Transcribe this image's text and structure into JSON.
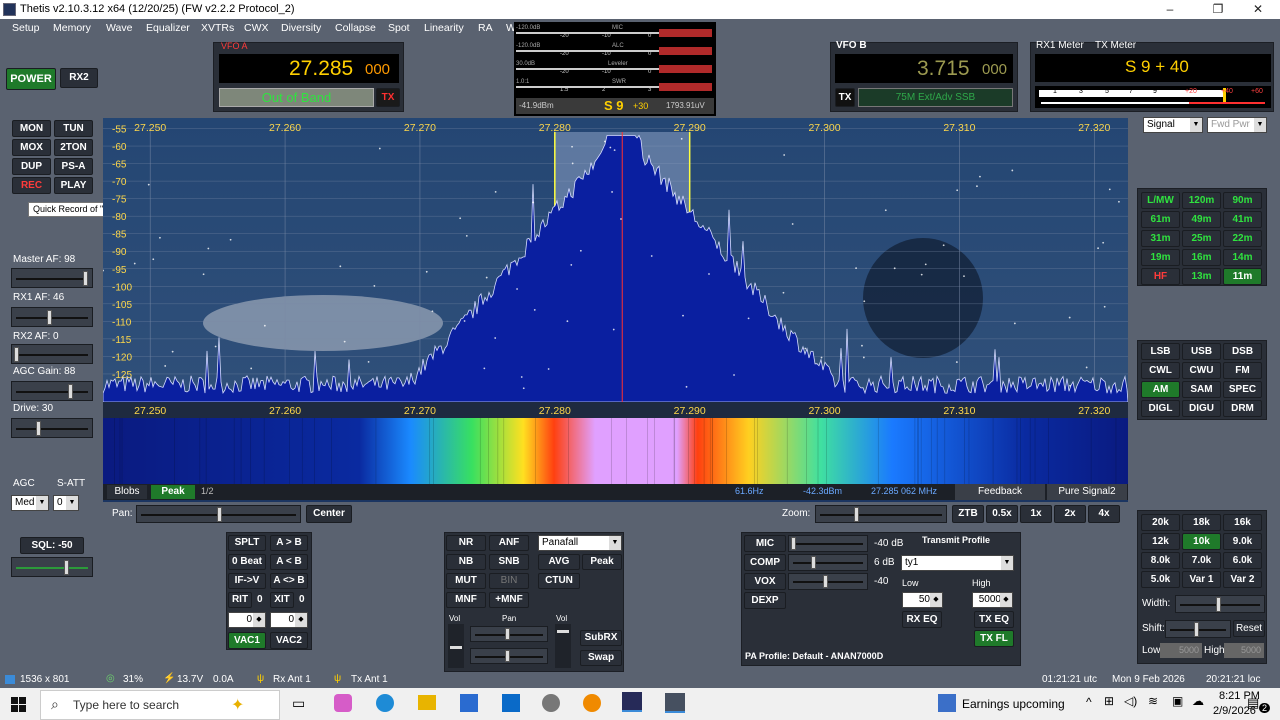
{
  "window": {
    "title": "Thetis v2.10.3.12 x64 (12/20/25) (FW v2.2.2 Protocol_2)",
    "minimize": "–",
    "maximize": "❐",
    "close": "✕"
  },
  "menu": [
    "Setup",
    "Memory",
    "Wave",
    "Equalizer",
    "XVTRs",
    "CWX",
    "Diversity",
    "Collapse",
    "Spot",
    "Linearity",
    "RA",
    "W"
  ],
  "power": {
    "power": "POWER",
    "rx2": "RX2"
  },
  "vfo_a": {
    "label": "VFO A",
    "freq_main": "27.285",
    "freq_sub": "000",
    "band_text": "Out of Band",
    "tx": "TX"
  },
  "meter_center": {
    "rows": [
      {
        "tag": "-120.0dB",
        "label": "MIC",
        "ticks": [
          "-20",
          "-10",
          "0"
        ]
      },
      {
        "tag": "-120.0dB",
        "label": "ALC",
        "ticks": [
          "-20",
          "-10",
          "0"
        ]
      },
      {
        "tag": "30.0dB",
        "label": "Leveler",
        "ticks": [
          "-20",
          "-10",
          "0"
        ]
      },
      {
        "tag": "1.0:1",
        "label": "SWR",
        "ticks": [
          "1.5",
          "2",
          "3"
        ]
      }
    ],
    "dbm": "-41.9dBm",
    "smeter": "S 9",
    "smeter_plus": "+30",
    "uv": "1793.91uV"
  },
  "vfo_b": {
    "label": "VFO B",
    "freq_main": "3.715",
    "freq_sub": "000",
    "tx": "TX",
    "band_text": "75M Ext/Adv SSB"
  },
  "rx1_meter": {
    "label": "RX1 Meter",
    "tx_label": "TX Meter",
    "reading": "S 9 + 40",
    "ticks": [
      "1",
      "3",
      "5",
      "7",
      "9",
      "+20",
      "+40",
      "+60"
    ],
    "signal_select": "Signal",
    "fwd_select": "Fwd Pwr"
  },
  "left_buttons": [
    {
      "label": "MON",
      "state": "normal"
    },
    {
      "label": "TUN",
      "state": "normal"
    },
    {
      "label": "MOX",
      "state": "normal"
    },
    {
      "label": "2TON",
      "state": "normal"
    },
    {
      "label": "DUP",
      "state": "normal"
    },
    {
      "label": "PS-A",
      "state": "normal"
    },
    {
      "label": "REC",
      "state": "red"
    },
    {
      "label": "PLAY",
      "state": "normal"
    }
  ],
  "tooltip": "Quick Record of \"off the air\" signals",
  "sliders_left": [
    {
      "label": "Master AF:  98",
      "level": 0.98
    },
    {
      "label": "RX1 AF:  46",
      "level": 0.46
    },
    {
      "label": "RX2 AF:  0",
      "level": 0.0
    },
    {
      "label": "AGC Gain:  88",
      "level": 0.7
    },
    {
      "label": "Drive:  30",
      "level": 0.3
    }
  ],
  "agc": {
    "label": "AGC",
    "satt_label": "S-ATT",
    "mode": "Med",
    "satt": "0"
  },
  "sql": {
    "label": "SQL: -50"
  },
  "spectrum": {
    "freq_ticks": [
      "27.250",
      "27.260",
      "27.270",
      "27.280",
      "27.290",
      "27.300",
      "27.310",
      "27.320"
    ],
    "wf_freq_ticks": [
      "27.250",
      "27.260",
      "27.270",
      "27.280",
      "27.290",
      "27.300",
      "27.310",
      "27.320"
    ],
    "db_ticks": [
      "-55",
      "-60",
      "-65",
      "-70",
      "-75",
      "-80",
      "-85",
      "-90",
      "-95",
      "-100",
      "-105",
      "-110",
      "-115",
      "-120",
      "-125",
      "-130"
    ],
    "filter_low": 27.28,
    "filter_high": 27.29,
    "center": 27.285,
    "range": [
      27.2465,
      27.3225
    ]
  },
  "display_footer": {
    "blobs": "Blobs",
    "peak": "Peak",
    "page": "1/2",
    "hz": "61.6Hz",
    "dbm": "-42.3dBm",
    "mhz": "27.285 062 MHz",
    "feedback": "Feedback",
    "pure_signal": "Pure Signal2"
  },
  "pan_zoom": {
    "pan_label": "Pan:",
    "center": "Center",
    "zoom_label": "Zoom:",
    "ztb": "ZTB",
    "z05": "0.5x",
    "z1": "1x",
    "z2": "2x",
    "z4": "4x"
  },
  "band_buttons": [
    "L/MW",
    "120m",
    "90m",
    "61m",
    "49m",
    "41m",
    "31m",
    "25m",
    "22m",
    "19m",
    "16m",
    "14m",
    "HF",
    "13m",
    "11m"
  ],
  "mode_buttons": [
    "LSB",
    "USB",
    "DSB",
    "CWL",
    "CWU",
    "FM",
    "AM",
    "SAM",
    "SPEC",
    "DIGL",
    "DIGU",
    "DRM"
  ],
  "filter_buttons": [
    "20k",
    "18k",
    "16k",
    "12k",
    "10k",
    "9.0k",
    "8.0k",
    "7.0k",
    "6.0k",
    "5.0k",
    "Var 1",
    "Var 2"
  ],
  "filter_extra": {
    "width": "Width:",
    "shift": "Shift:",
    "reset": "Reset",
    "low": "Low",
    "high": "High",
    "low_val": "5000",
    "high_val": "5000"
  },
  "split_block": {
    "splt": "SPLT",
    "ab": "A > B",
    "zerobeat": "0 Beat",
    "ba": "A < B",
    "ifv": "IF->V",
    "swap": "A <> B",
    "rit": "RIT",
    "rit_val": "0",
    "xit": "XIT",
    "xit_val": "0",
    "rit_spin": "0",
    "xit_spin": "0",
    "vac1": "VAC1",
    "vac2": "VAC2"
  },
  "dsp_block": {
    "nr": "NR",
    "anf": "ANF",
    "nb": "NB",
    "snb": "SNB",
    "mut": "MUT",
    "bin": "BIN",
    "mnf": "MNF",
    "pmnf": "+MNF",
    "panafall": "Panafall",
    "avg": "AVG",
    "peak": "Peak",
    "ctun": "CTUN",
    "vol": "Vol",
    "pan": "Pan",
    "vol2": "Vol",
    "subrx": "SubRX",
    "swap": "Swap"
  },
  "tx_block": {
    "mic": "MIC",
    "mic_db": "-40 dB",
    "comp": "COMP",
    "comp_db": "6 dB",
    "vox": "VOX",
    "vox_val": "-40",
    "dexp": "DEXP",
    "profile_label": "Transmit Profile",
    "profile": "ty1",
    "low": "Low",
    "high": "High",
    "low_val": "50",
    "high_val": "5000",
    "rxeq": "RX EQ",
    "txeq": "TX EQ",
    "txfl": "TX FL",
    "pa_profile": "PA Profile: Default - ANAN7000D"
  },
  "status": {
    "res": "1536 x 801",
    "cpu": "31%",
    "volt": "13.7V",
    "amp": "0.0A",
    "rxant": "Rx Ant 1",
    "txant": "Tx Ant 1",
    "utc": "01:21:21 utc",
    "date": "Mon 9 Feb 2026",
    "loc": "20:21:21 loc"
  },
  "taskbar": {
    "search": "Type here to search",
    "news": "Earnings upcoming",
    "time": "8:21 PM",
    "date": "2/9/2026",
    "notif": "2"
  },
  "colors": {
    "accent_green": "#1f7a2a",
    "lcd_yellow": "#ffd000",
    "panel": "#2a2f38",
    "spectrum_bg": "#1b3561",
    "spectrum_fill": "#0a1fa0"
  }
}
